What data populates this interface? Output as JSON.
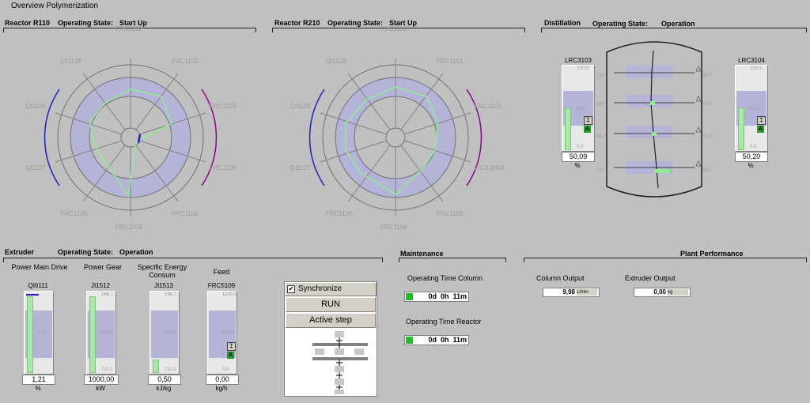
{
  "page_title": "Overview Polymerization",
  "reactor1": {
    "name": "Reactor R110",
    "state_label": "Operating State:",
    "state_value": "Start Up",
    "labels": [
      "FRC1102",
      "FRC1101",
      "FRC1103",
      "FRC1126",
      "FRC1105",
      "FRC1104",
      "FRC1106",
      "QI1127",
      "QI1129",
      "QI1128"
    ]
  },
  "reactor2": {
    "name": "Reactor R210",
    "state_label": "Operating State:",
    "state_value": "Start Up",
    "labels": [
      "FRC1102",
      "FRC1101",
      "FRC1103",
      "FIC3106/3",
      "FRC1105",
      "FRC1104",
      "FRC1106",
      "QI1127",
      "QI1129",
      "QI1128"
    ]
  },
  "distillation": {
    "name": "Distillation",
    "state_label": "Operating State:",
    "state_value": "Operation",
    "left_gauge": {
      "tag": "LRC3103",
      "value": "50,09",
      "unit": "%",
      "scale_top": "100,0",
      "scale_mid": "50,0",
      "scale_bot": "0,0",
      "fill": 0.5
    },
    "right_gauge": {
      "tag": "LRC3104",
      "value": "50,20",
      "unit": "%",
      "scale_top": "100,0",
      "scale_mid": "50,0",
      "scale_bot": "0,0",
      "fill": 0.5
    },
    "left_temps": [
      "53,5",
      "66,7",
      "66,7",
      "71,7"
    ],
    "right_temps": [
      "56,7",
      "55,2",
      "55,3",
      "56,2"
    ]
  },
  "extruder": {
    "name": "Extruder",
    "state_label": "Operating State:",
    "state_value": "Operation",
    "gauges": [
      {
        "title": "Power Main Drive",
        "tag": "QI6111",
        "value": "1,21",
        "unit": "%",
        "scale_top": "",
        "scale_mid": "0,9",
        "scale_bot": "",
        "fill": 0.95
      },
      {
        "title": "Power Gear",
        "tag": "JI1512",
        "value": "1000,00",
        "unit": "kW",
        "scale_top": "166,7",
        "scale_mid": "800,0",
        "scale_bot": "711,1",
        "fill": 0.95
      },
      {
        "title": "Specific Energy Consum",
        "tag": "JI1513",
        "value": "0,50",
        "unit": "kJ/kg",
        "scale_top": "166,7",
        "scale_mid": "800,0",
        "scale_bot": "711,1",
        "fill": 0.15
      },
      {
        "title": "Feed",
        "tag": "FRC5109",
        "value": "0,00",
        "unit": "kg/h",
        "scale_top": "1100,0",
        "scale_mid": "550,0",
        "scale_bot": "0,0",
        "fill": 0.0
      }
    ]
  },
  "sfc": {
    "sync_label": "Synchronize",
    "sync_checked": true,
    "run_label": "RUN",
    "active_step_label": "Active step"
  },
  "maintenance": {
    "name": "Maintenance",
    "column_label": "Operating Time Column",
    "column_value": "0d  0h  11m",
    "reactor_label": "Operating Time Reactor",
    "reactor_value": "0d  0h  11m"
  },
  "plant": {
    "name": "Plant Performance",
    "column_output_label": "Column Output",
    "column_output_value": "9,98",
    "column_output_unit": "L/min",
    "extruder_output_label": "Extruder Output",
    "extruder_output_value": "0,00",
    "extruder_output_unit": "kg"
  },
  "colors": {
    "background": "#c0c0c0",
    "accent_green": "#90ee90",
    "band_blue": "#b4b4d8",
    "arc_blue": "#2020c0",
    "arc_purple": "#900090"
  }
}
